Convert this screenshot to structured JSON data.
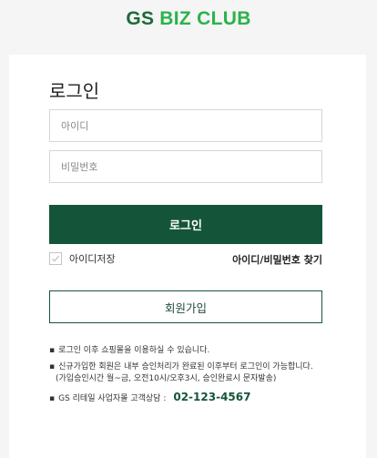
{
  "header": {
    "logo_gs": "GS",
    "logo_rest": "BIZ CLUB",
    "colors": {
      "gs": "#1b6b3a",
      "biz": "#2bb24c"
    }
  },
  "login": {
    "title": "로그인",
    "id_placeholder": "아이디",
    "pw_placeholder": "비밀번호",
    "submit_label": "로그인",
    "remember_label": "아이디저장",
    "remember_checked": true,
    "find_link": "아이디/비밀번호 찾기",
    "join_label": "회원가입",
    "colors": {
      "primary": "#14553a"
    }
  },
  "notices": {
    "bullet": "▪",
    "line1": "로그인 이후 쇼핑몰을 이용하실 수 있습니다.",
    "line2": "신규가입한 회원은 내부 승인처리가 완료된 이후부터 로그인이 가능합니다.",
    "line2_sub": "(가입승인시간 월~금, 오전10시/오후3시, 승인완료시 문자발송)",
    "contact_label": "GS 리테일 사업자몰 고객상담 :",
    "contact_phone": "02-123-4567"
  }
}
